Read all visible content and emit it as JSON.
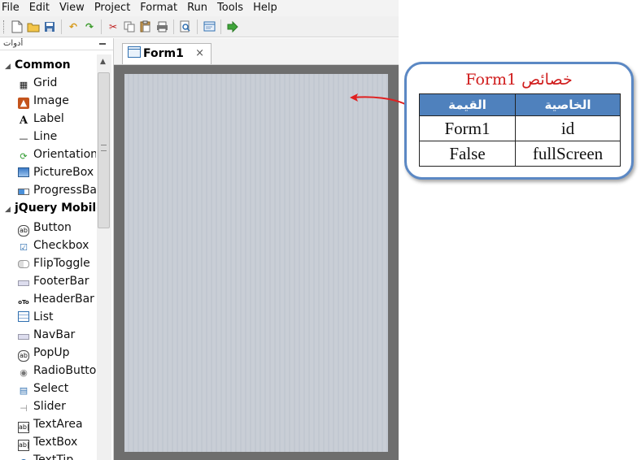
{
  "menu": [
    "File",
    "Edit",
    "View",
    "Project",
    "Format",
    "Run",
    "Tools",
    "Help"
  ],
  "toolbar": {
    "icons": [
      "new-file-icon",
      "open-folder-icon",
      "save-icon",
      "undo-icon",
      "redo-icon",
      "cut-icon",
      "copy-icon",
      "paste-icon",
      "print-icon",
      "print-preview-icon",
      "form-icon",
      "run-icon"
    ]
  },
  "tools_panel": {
    "title": "أدوات",
    "groups": [
      {
        "name": "Common",
        "items": [
          {
            "label": "Grid",
            "icon": "grid-icon"
          },
          {
            "label": "Image",
            "icon": "image-icon"
          },
          {
            "label": "Label",
            "icon": "label-icon"
          },
          {
            "label": "Line",
            "icon": "line-icon"
          },
          {
            "label": "Orientation",
            "icon": "orientation-icon"
          },
          {
            "label": "PictureBox",
            "icon": "picturebox-icon"
          },
          {
            "label": "ProgressBar",
            "icon": "progressbar-icon"
          }
        ]
      },
      {
        "name": "jQuery Mobile",
        "items": [
          {
            "label": "Button",
            "icon": "button-icon"
          },
          {
            "label": "Checkbox",
            "icon": "checkbox-icon"
          },
          {
            "label": "FlipToggle",
            "icon": "fliptoggle-icon"
          },
          {
            "label": "FooterBar",
            "icon": "footerbar-icon"
          },
          {
            "label": "HeaderBar",
            "icon": "headerbar-icon"
          },
          {
            "label": "List",
            "icon": "list-icon"
          },
          {
            "label": "NavBar",
            "icon": "navbar-icon"
          },
          {
            "label": "PopUp",
            "icon": "popup-icon"
          },
          {
            "label": "RadioButton",
            "icon": "radiobutton-icon"
          },
          {
            "label": "Select",
            "icon": "select-icon"
          },
          {
            "label": "Slider",
            "icon": "slider-icon"
          },
          {
            "label": "TextArea",
            "icon": "textarea-icon"
          },
          {
            "label": "TextBox",
            "icon": "textbox-icon"
          },
          {
            "label": "TextTip",
            "icon": "texttip-icon"
          }
        ]
      }
    ]
  },
  "editor": {
    "tab_label": "Form1",
    "tab_close": "×"
  },
  "callout": {
    "title": "خصائص Form1",
    "headers": [
      "القيمة",
      "الخاصية"
    ],
    "rows": [
      [
        "Form1",
        "id"
      ],
      [
        "False",
        "fullScreen"
      ]
    ],
    "title_color": "#d01c1c",
    "header_color": "#4f81bd",
    "border_color": "#5b88c4"
  }
}
